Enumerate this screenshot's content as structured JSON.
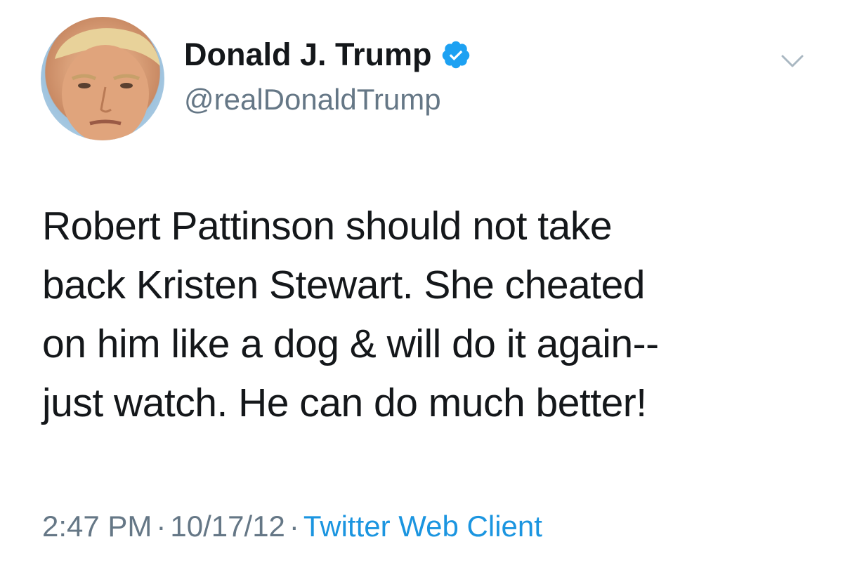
{
  "author": {
    "display_name": "Donald J. Trump",
    "handle": "@realDonaldTrump",
    "verified": true,
    "avatar": "profile-photo"
  },
  "tweet": {
    "text": "Robert Pattinson should not take\nback Kristen Stewart. She cheated\non him like a dog & will do it again--\njust watch. He can do much better!",
    "time": "2:47 PM",
    "date": "10/17/12",
    "separator": "·",
    "source": "Twitter Web Client"
  },
  "icons": {
    "verified": "verified-badge-icon",
    "menu": "chevron-down-icon"
  },
  "colors": {
    "text": "#14171a",
    "muted": "#657786",
    "link": "#1b95e0",
    "verified": "#1da1f2"
  }
}
